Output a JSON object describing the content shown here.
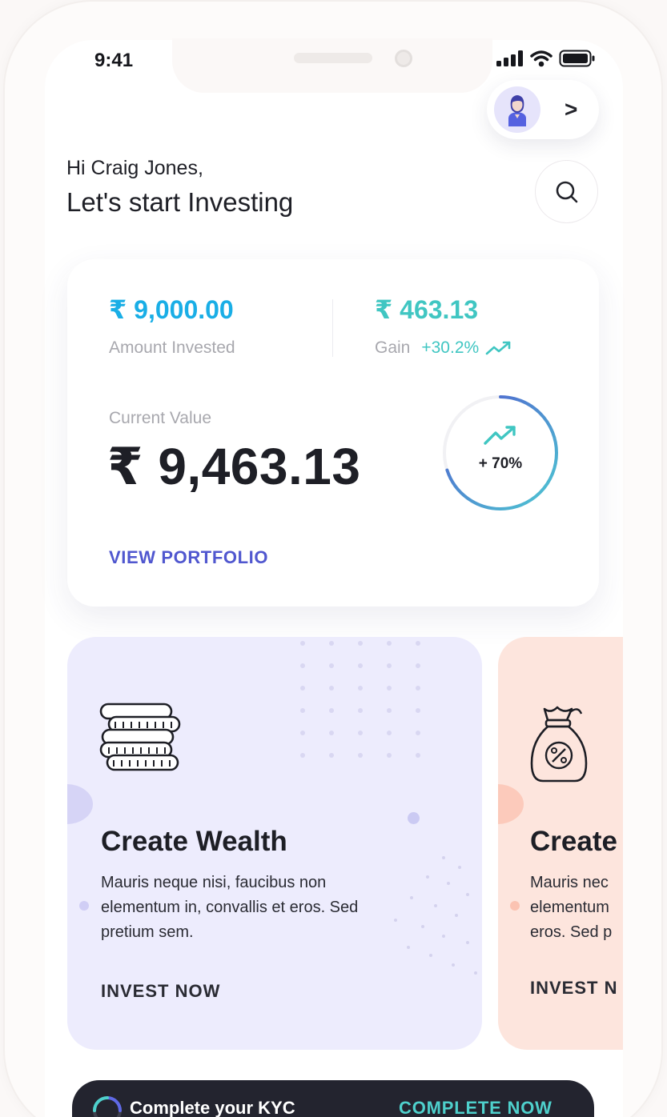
{
  "status_bar": {
    "time": "9:41",
    "icons": [
      "signal-icon",
      "wifi-icon",
      "battery-icon"
    ]
  },
  "header": {
    "greeting": "Hi Craig Jones,",
    "headline": "Let's start Investing",
    "avatar_icon": "user-avatar-icon",
    "chevron": ">"
  },
  "portfolio": {
    "amount_invested_value": "₹ 9,000.00",
    "amount_invested_label": "Amount Invested",
    "gain_value": "₹ 463.13",
    "gain_label": "Gain",
    "gain_percent": "+30.2%",
    "current_value_label": "Current Value",
    "current_value": "₹ 9,463.13",
    "ring_percent": "+ 70%",
    "ring_progress": 0.7,
    "view_link": "VIEW PORTFOLIO"
  },
  "promos": [
    {
      "title": "Create Wealth",
      "text": "Mauris neque nisi, faucibus non elementum in, convallis et eros. Sed pretium sem.",
      "cta": "INVEST NOW",
      "icon": "coins-stack-icon"
    },
    {
      "title": "Create",
      "text_lines": [
        "Mauris nec",
        "elementum",
        "eros. Sed p"
      ],
      "cta": "INVEST N",
      "icon": "money-bag-percent-icon"
    }
  ],
  "kyc": {
    "text": "Complete your KYC",
    "cta": "COMPLETE NOW"
  },
  "colors": {
    "accent_blue": "#19aee6",
    "accent_teal": "#40c6c2",
    "accent_purple": "#5057cf",
    "promo_lavender": "#edecfd",
    "promo_peach": "#fde5dd",
    "dark": "#23242f"
  }
}
